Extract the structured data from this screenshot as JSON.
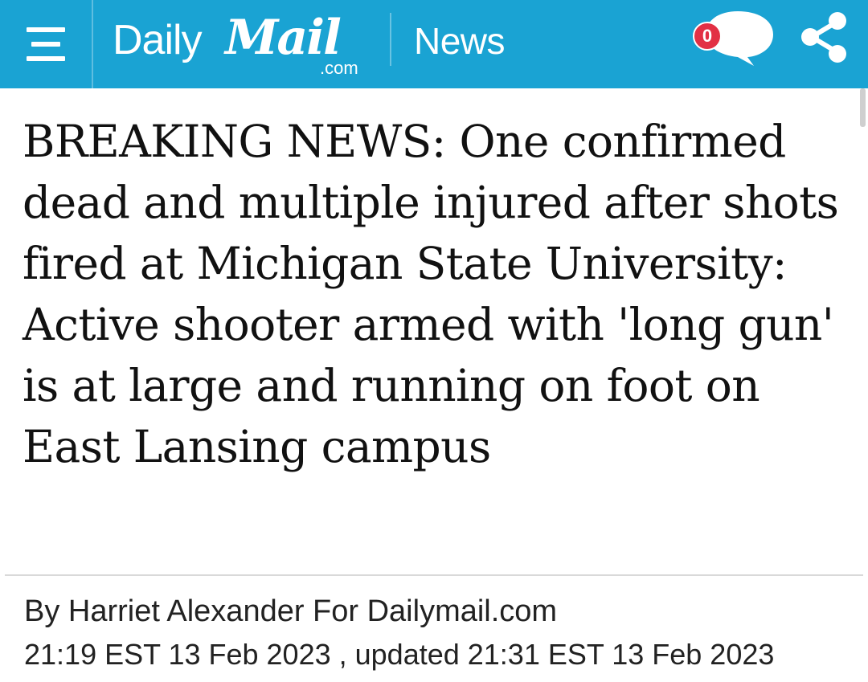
{
  "header": {
    "menu_icon": "hamburger-menu-icon",
    "logo": {
      "word1": "Daily",
      "word2": "Mail",
      "suffix": ".com"
    },
    "section": "News",
    "comments": {
      "icon": "speech-bubble-icon",
      "count": "0"
    },
    "share_icon": "share-icon"
  },
  "article": {
    "headline": "BREAKING NEWS: One confirmed dead and multiple injured after shots fired at Michigan State University: Active shooter armed with 'long gun' is at large and running on foot on East Lansing campus",
    "byline": "By Harriet Alexander For Dailymail.com",
    "published": "21:19 EST 13 Feb 2023",
    "updated_separator": " , updated ",
    "updated": "21:31 EST 13 Feb 2023"
  },
  "colors": {
    "header_bg": "#1aa3d3",
    "badge": "#e23044",
    "text": "#111111"
  }
}
